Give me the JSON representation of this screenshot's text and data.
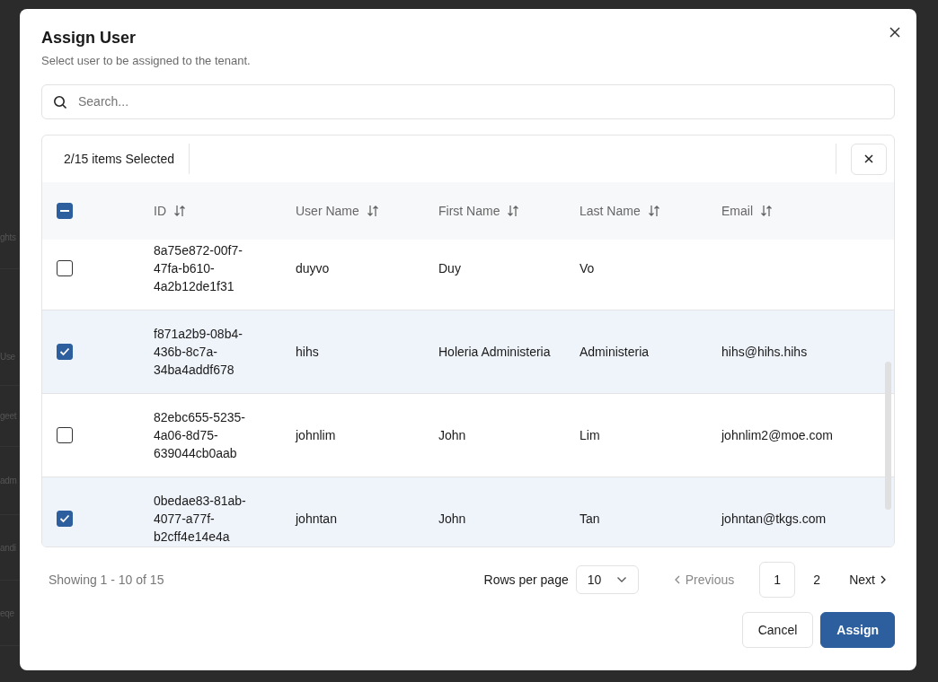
{
  "background_fragments": [
    "ghts",
    "Use",
    "geet",
    "adm",
    "andi",
    "eqe"
  ],
  "dialog": {
    "title": "Assign User",
    "subtitle": "Select user to be assigned to the tenant.",
    "search": {
      "placeholder": "Search..."
    },
    "selection_summary": "2/15 items Selected",
    "table": {
      "select_all_indeterminate": true,
      "columns": [
        {
          "label": "ID",
          "sortable": true
        },
        {
          "label": "User Name",
          "sortable": true
        },
        {
          "label": "First Name",
          "sortable": true
        },
        {
          "label": "Last Name",
          "sortable": true
        },
        {
          "label": "Email",
          "sortable": true
        }
      ],
      "rows": [
        {
          "selected": false,
          "cells": [
            "8a75e872-00f7-47fa-b610-4a2b12de1f31",
            "duyvo",
            "Duy",
            "Vo"
          ]
        },
        {
          "selected": true,
          "cells": [
            "f871a2b9-08b4-436b-8c7a-34ba4addf678",
            "hihs",
            "Holeria Administeria",
            "Administeria",
            "hihs@hihs.hihs"
          ]
        },
        {
          "selected": false,
          "cells": [
            "82ebc655-5235-4a06-8d75-639044cb0aab",
            "johnlim",
            "John",
            "Lim",
            "johnlim2@moe.com"
          ]
        },
        {
          "selected": true,
          "cells": [
            "0bedae83-81ab-4077-a77f-b2cff4e14e4a",
            "johntan",
            "John",
            "Tan",
            "johntan@tkgs.com"
          ]
        }
      ]
    },
    "footer": {
      "showing": "Showing 1 - 10 of 15",
      "rows_per_page_label": "Rows per page",
      "rows_per_page": "10",
      "previous": {
        "label": "Previous",
        "disabled": true
      },
      "pages": [
        {
          "label": "1",
          "selected": true
        },
        {
          "label": "2",
          "selected": false
        }
      ],
      "next": {
        "label": "Next",
        "disabled": false
      }
    },
    "buttons": [
      {
        "label": "Cancel",
        "kind": "secondary"
      },
      {
        "label": "Assign",
        "kind": "primary"
      }
    ]
  }
}
